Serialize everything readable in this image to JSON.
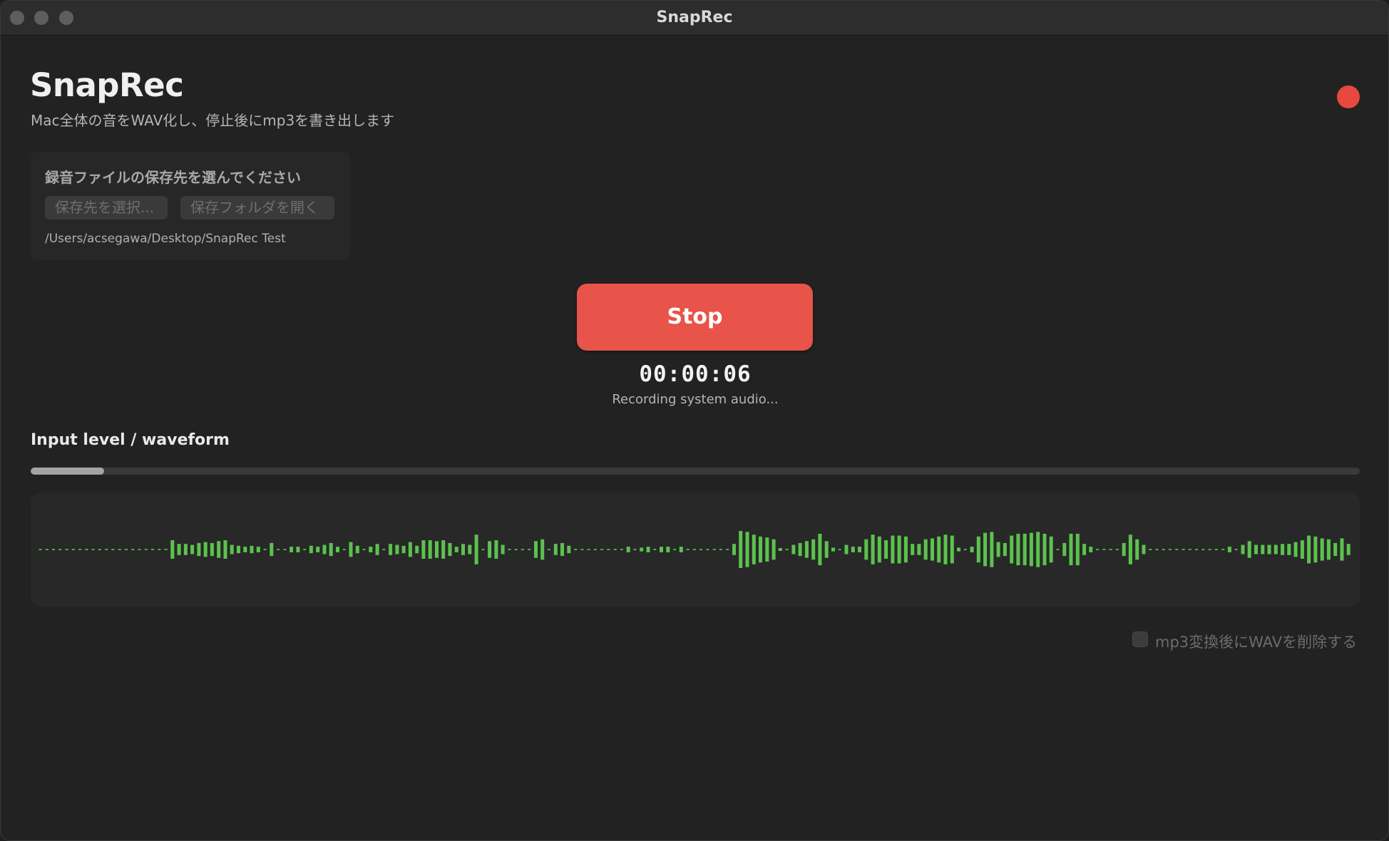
{
  "window": {
    "title": "SnapRec"
  },
  "header": {
    "title": "SnapRec",
    "subtitle": "Mac全体の音をWAV化し、停止後にmp3を書き出します",
    "recording_indicator_color": "#e8493f"
  },
  "save_location": {
    "heading": "録音ファイルの保存先を選んでください",
    "choose_button_label": "保存先を選択...",
    "open_folder_button_label": "保存フォルダを開く",
    "path": "/Users/acsegawa/Desktop/SnapRec Test"
  },
  "recorder": {
    "stop_button_label": "Stop",
    "stop_button_color": "#e8534a",
    "elapsed_time": "00:00:06",
    "status_text": "Recording system audio..."
  },
  "level": {
    "heading": "Input level / waveform",
    "input_level": 0.055,
    "waveform_color": "#5cc24e",
    "waveform_amplitudes": [
      0,
      0,
      0,
      0,
      0,
      0,
      0,
      0,
      0,
      0,
      0,
      0,
      0,
      0,
      0,
      0,
      0,
      0,
      0,
      0,
      0.5,
      0.3,
      0.3,
      0.25,
      0.35,
      0.4,
      0.35,
      0.45,
      0.5,
      0.25,
      0.2,
      0.15,
      0.2,
      0.15,
      0,
      0.35,
      0,
      0,
      0.15,
      0.15,
      0,
      0.2,
      0.15,
      0.25,
      0.35,
      0.15,
      0,
      0.4,
      0.2,
      0,
      0.15,
      0.3,
      0,
      0.3,
      0.25,
      0.2,
      0.4,
      0.2,
      0.5,
      0.5,
      0.45,
      0.5,
      0.35,
      0.15,
      0.3,
      0.25,
      0.8,
      0,
      0.45,
      0.5,
      0.25,
      0,
      0,
      0,
      0,
      0.45,
      0.55,
      0,
      0.3,
      0.35,
      0.2,
      0,
      0,
      0,
      0,
      0,
      0,
      0,
      0,
      0.15,
      0,
      0.1,
      0.15,
      0,
      0.15,
      0.15,
      0,
      0.15,
      0,
      0,
      0,
      0,
      0,
      0,
      0,
      0.3,
      1,
      0.95,
      0.8,
      0.7,
      0.65,
      0.55,
      0.05,
      0,
      0.25,
      0.35,
      0.45,
      0.55,
      0.85,
      0.45,
      0.1,
      0,
      0.25,
      0.15,
      0.15,
      0.55,
      0.8,
      0.7,
      0.5,
      0.75,
      0.75,
      0.7,
      0.3,
      0.3,
      0.55,
      0.6,
      0.7,
      0.8,
      0.75,
      0.1,
      0,
      0.15,
      0.7,
      0.9,
      0.95,
      0.4,
      0.35,
      0.75,
      0.85,
      0.85,
      0.9,
      0.95,
      0.85,
      0.7,
      0,
      0.35,
      0.85,
      0.85,
      0.3,
      0.15,
      0,
      0,
      0,
      0,
      0.35,
      0.8,
      0.55,
      0.25,
      0,
      0,
      0,
      0,
      0,
      0,
      0,
      0,
      0,
      0,
      0,
      0,
      0.15,
      0,
      0.25,
      0.45,
      0.25,
      0.25,
      0.25,
      0.25,
      0.3,
      0.3,
      0.4,
      0.5,
      0.75,
      0.7,
      0.6,
      0.55,
      0.35,
      0.6,
      0.3
    ]
  },
  "options": {
    "delete_wav_label": "mp3変換後にWAVを削除する",
    "delete_wav_checked": false
  }
}
